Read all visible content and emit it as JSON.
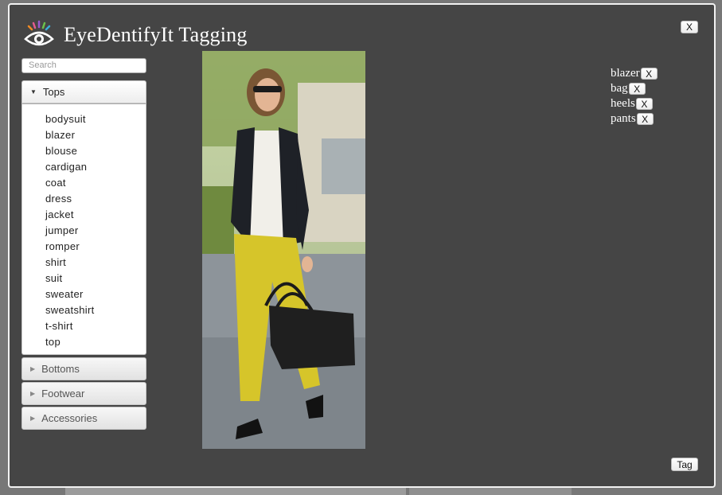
{
  "window": {
    "title": "EyeDentifyIt Tagging",
    "close_label": "X"
  },
  "search": {
    "placeholder": "Search",
    "value": ""
  },
  "categories": [
    {
      "label": "Tops",
      "expanded": true,
      "items": [
        "bodysuit",
        "blazer",
        "blouse",
        "cardigan",
        "coat",
        "dress",
        "jacket",
        "jumper",
        "romper",
        "shirt",
        "suit",
        "sweater",
        "sweatshirt",
        "t-shirt",
        "top"
      ]
    },
    {
      "label": "Bottoms",
      "expanded": false
    },
    {
      "label": "Footwear",
      "expanded": false
    },
    {
      "label": "Accessories",
      "expanded": false
    }
  ],
  "tags": [
    {
      "label": "blazer",
      "remove_label": "X"
    },
    {
      "label": "bag",
      "remove_label": "X"
    },
    {
      "label": "heels",
      "remove_label": "X"
    },
    {
      "label": "pants",
      "remove_label": "X"
    }
  ],
  "actions": {
    "tag_label": "Tag"
  },
  "icons": {
    "logo": "eye-logo-icon",
    "expand": "triangle-down-icon",
    "collapse": "triangle-right-icon"
  },
  "colors": {
    "modal_bg": "#454545",
    "modal_border": "#f2f2f2",
    "panel_bg": "#ffffff"
  }
}
